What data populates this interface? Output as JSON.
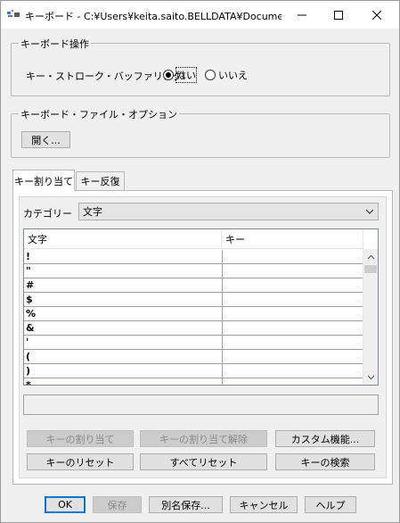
{
  "window": {
    "title": "キーボード - C:¥Users¥keita.saito.BELLDATA¥Docume...",
    "minimize": "minimize",
    "maximize": "maximize",
    "close": "close"
  },
  "keyboard_ops": {
    "legend": "キーボード操作",
    "buffer_label": "キー・ストローク・バッファリング:",
    "yes": "はい",
    "no": "いいえ",
    "selected": "yes"
  },
  "file_options": {
    "legend": "キーボード・ファイル・オプション",
    "open_button": "開く..."
  },
  "tabs": [
    {
      "label": "キー割り当て",
      "active": true
    },
    {
      "label": "キー反復",
      "active": false
    }
  ],
  "category": {
    "label": "カテゴリー",
    "value": "文字"
  },
  "table": {
    "columns": [
      "文字",
      "キー"
    ],
    "rows": [
      {
        "char": "!",
        "key": ""
      },
      {
        "char": "\"",
        "key": ""
      },
      {
        "char": "#",
        "key": ""
      },
      {
        "char": "$",
        "key": ""
      },
      {
        "char": "%",
        "key": ""
      },
      {
        "char": "&",
        "key": ""
      },
      {
        "char": "'",
        "key": ""
      },
      {
        "char": "(",
        "key": ""
      },
      {
        "char": ")",
        "key": ""
      },
      {
        "char": "*",
        "key": ""
      }
    ]
  },
  "action_buttons": {
    "assign": "キーの割り当て",
    "unassign": "キーの割り当て解除",
    "custom": "カスタム機能...",
    "reset_key": "キーのリセット",
    "reset_all": "すべてリセット",
    "search_key": "キーの検索"
  },
  "footer": {
    "ok": "OK",
    "save": "保存",
    "save_as": "別名保存...",
    "cancel": "キャンセル",
    "help": "ヘルプ"
  }
}
